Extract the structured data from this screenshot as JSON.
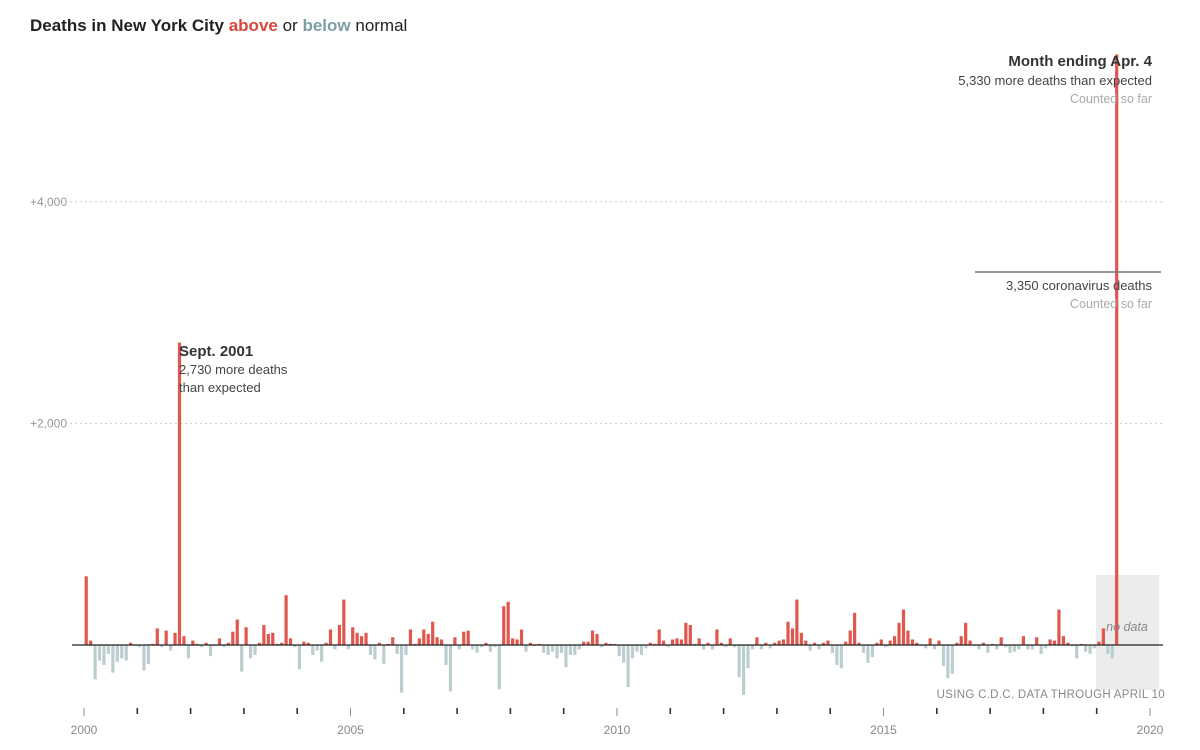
{
  "title": {
    "prefix": "Deaths in New York City",
    "above": "above",
    "or": "or",
    "below": "below",
    "suffix": "normal"
  },
  "colors": {
    "above": "#e0574d",
    "below": "#bccdd0",
    "axis": "#222222",
    "grid": "#cccccc",
    "nodata_shade": "#ececec"
  },
  "annotations": {
    "sept2001": {
      "title": "Sept. 2001",
      "line1": "2,730 more deaths",
      "line2": "than expected"
    },
    "apr2020": {
      "title": "Month ending Apr. 4",
      "line1": "5,330 more deaths than expected",
      "line2": "Counted so far"
    },
    "covid": {
      "line1": "3,350 coronavirus deaths",
      "line2": "Counted so far"
    },
    "no_data": "no data",
    "source": "USING C.D.C. DATA THROUGH APRIL 10"
  },
  "chart_data": {
    "type": "bar",
    "title": "Deaths in New York City above or below normal",
    "x_unit": "month",
    "x_start": "2000-01",
    "x_end": "2020-03",
    "xticks": [
      "2000",
      "2005",
      "2010",
      "2015",
      "2020"
    ],
    "yticks": [
      "+2,000",
      "+4,000"
    ],
    "ylim": [
      -500,
      5400
    ],
    "grid": true,
    "no_data_range": [
      "2019-01",
      "2020-02"
    ],
    "values": [
      620,
      40,
      -310,
      -140,
      -180,
      -80,
      -250,
      -150,
      -120,
      -140,
      20,
      -10,
      -20,
      -230,
      -170,
      10,
      150,
      -20,
      130,
      -50,
      110,
      2730,
      80,
      -120,
      40,
      10,
      -20,
      20,
      -100,
      -10,
      60,
      -20,
      20,
      120,
      230,
      -240,
      160,
      -120,
      -90,
      20,
      180,
      100,
      110,
      10,
      20,
      450,
      60,
      -20,
      -220,
      30,
      20,
      -90,
      -50,
      -150,
      20,
      140,
      -40,
      180,
      410,
      -40,
      160,
      110,
      80,
      110,
      -90,
      -130,
      20,
      -170,
      10,
      70,
      -80,
      -430,
      -90,
      140,
      10,
      60,
      140,
      100,
      210,
      70,
      50,
      -180,
      -420,
      70,
      -40,
      120,
      130,
      -40,
      -70,
      -20,
      20,
      -60,
      -20,
      -400,
      350,
      390,
      60,
      50,
      140,
      -60,
      20,
      0,
      10,
      -70,
      -90,
      -60,
      -120,
      -70,
      -200,
      -90,
      -90,
      -40,
      30,
      30,
      130,
      100,
      -20,
      20,
      10,
      10,
      -100,
      -160,
      -380,
      -120,
      -60,
      -90,
      -30,
      20,
      10,
      140,
      40,
      -20,
      50,
      60,
      50,
      200,
      180,
      10,
      60,
      -40,
      20,
      -40,
      140,
      20,
      -20,
      60,
      -20,
      -290,
      -450,
      -210,
      -40,
      70,
      -40,
      20,
      -30,
      20,
      40,
      50,
      210,
      150,
      410,
      110,
      40,
      -50,
      20,
      -40,
      20,
      40,
      -70,
      -180,
      -210,
      30,
      130,
      290,
      20,
      -70,
      -160,
      -110,
      20,
      50,
      -20,
      40,
      80,
      200,
      320,
      130,
      50,
      20,
      -10,
      -30,
      60,
      -40,
      40,
      -190,
      -300,
      -260,
      20,
      80,
      200,
      40,
      -10,
      -40,
      20,
      -70,
      10,
      -40,
      70,
      -20,
      -70,
      -60,
      -40,
      80,
      -40,
      -40,
      70,
      -80,
      -30,
      50,
      40,
      320,
      80,
      20,
      -10,
      -120,
      10,
      -60,
      -80,
      -30,
      30,
      150,
      -80,
      -120,
      5330
    ]
  }
}
